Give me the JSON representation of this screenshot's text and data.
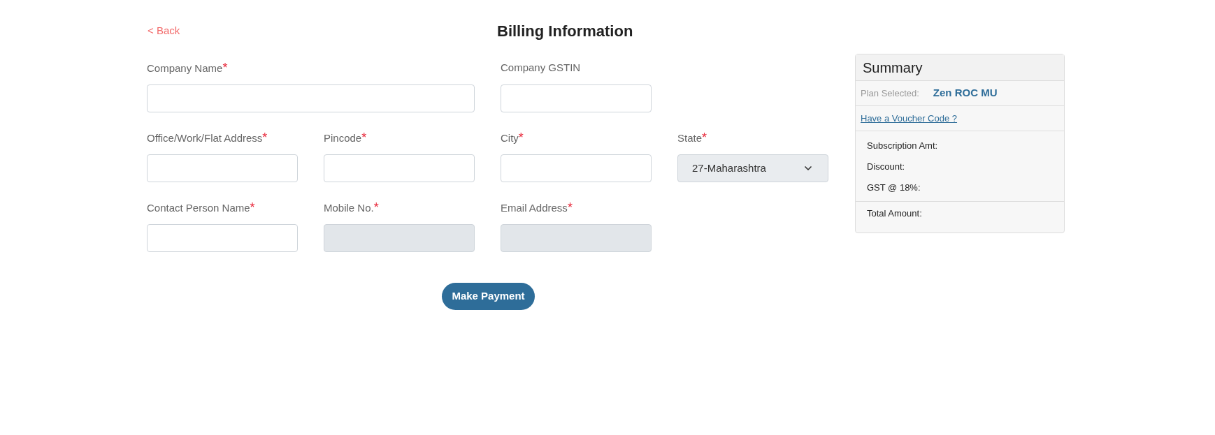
{
  "back_link": "< Back",
  "title": "Billing Information",
  "form_rows": [
    [
      {
        "label": "Company Name",
        "required_mark": "*",
        "kind": "text",
        "wide": true,
        "disabled": false
      },
      {
        "label": "Company GSTIN",
        "kind": "text",
        "wide": false,
        "disabled": false
      }
    ],
    [
      {
        "label": "Office/Work/Flat Address",
        "required_mark": "*",
        "kind": "text",
        "wide": false,
        "disabled": false
      },
      {
        "label": "Pincode",
        "required_mark": "*",
        "kind": "text",
        "wide": false,
        "disabled": false
      },
      {
        "label": "City",
        "required_mark": "*",
        "kind": "text",
        "wide": false,
        "disabled": false
      },
      {
        "label": "State",
        "required_mark": "*",
        "kind": "select",
        "value": "27-Maharashtra"
      }
    ],
    [
      {
        "label": "Contact Person Name",
        "required_mark": "*",
        "kind": "text",
        "wide": false,
        "disabled": false
      },
      {
        "label": "Mobile No.",
        "required_mark": "*",
        "kind": "text",
        "wide": false,
        "disabled": true
      },
      {
        "label": "Email Address",
        "required_mark": "*",
        "kind": "text",
        "wide": false,
        "disabled": true
      }
    ]
  ],
  "submit_button": "Make Payment",
  "summary": {
    "title": "Summary",
    "plan_label": "Plan Selected:",
    "plan_value": "Zen ROC MU",
    "voucher_link": "Have a Voucher Code ?",
    "charges": [
      "Subscription Amt:",
      "Discount:",
      "GST @ 18%:"
    ],
    "total_label": "Total Amount:"
  }
}
